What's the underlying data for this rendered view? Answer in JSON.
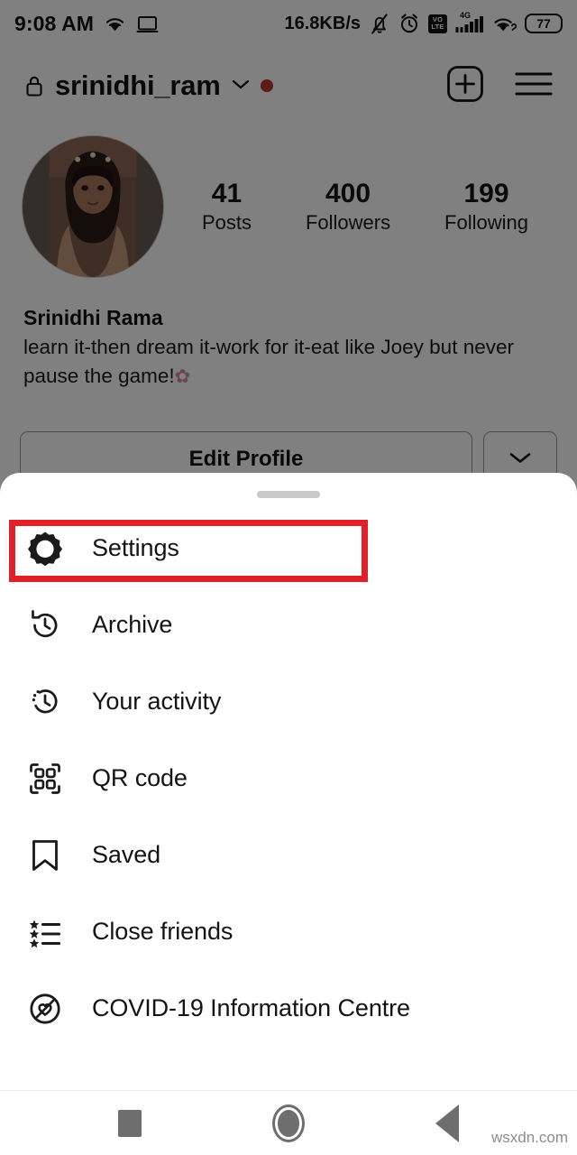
{
  "status_bar": {
    "time": "9:08 AM",
    "network_speed": "16.8KB/s",
    "battery_level": "77",
    "volte_top": "VO",
    "volte_bottom": "LTE",
    "network_generation": "4G",
    "icons": [
      "wifi-icon",
      "cast-screen-icon",
      "bell-muted-icon",
      "alarm-clock-icon",
      "volte-icon",
      "signal-bars-icon",
      "wifi-icon",
      "battery-icon"
    ]
  },
  "header": {
    "username": "srinidhi_ram",
    "lock_icon": "lock-icon",
    "chevron_icon": "chevron-down-icon",
    "badge_dot_color": "#b53830",
    "new_post_icon": "plus-box-icon",
    "menu_icon": "hamburger-menu-icon"
  },
  "profile": {
    "avatar_name": "profile-avatar",
    "full_name": "Srinidhi Rama",
    "bio_line1": "learn it-then dream it-work for it-eat like Joey but",
    "bio_line2": "never pause the game!",
    "bio_emoji": "✿",
    "stats": [
      {
        "value": "41",
        "label": "Posts"
      },
      {
        "value": "400",
        "label": "Followers"
      },
      {
        "value": "199",
        "label": "Following"
      }
    ],
    "edit_profile_label": "Edit Profile",
    "more_icon": "chevron-down-icon"
  },
  "sheet": {
    "handle": "drag-handle",
    "highlight_color": "#e02128",
    "items": [
      {
        "label": "Settings",
        "icon": "gear-icon",
        "highlighted": true
      },
      {
        "label": "Archive",
        "icon": "archive-clock-icon",
        "highlighted": false
      },
      {
        "label": "Your activity",
        "icon": "activity-clock-icon",
        "highlighted": false
      },
      {
        "label": "QR code",
        "icon": "qr-code-icon",
        "highlighted": false
      },
      {
        "label": "Saved",
        "icon": "bookmark-icon",
        "highlighted": false
      },
      {
        "label": "Close friends",
        "icon": "star-list-icon",
        "highlighted": false
      },
      {
        "label": "COVID-19 Information Centre",
        "icon": "covid-heart-icon",
        "highlighted": false
      }
    ]
  },
  "nav_bar": {
    "recents_icon": "square-recents-icon",
    "home_icon": "circle-home-icon",
    "back_icon": "triangle-back-icon"
  },
  "watermark": "wsxdn.com"
}
